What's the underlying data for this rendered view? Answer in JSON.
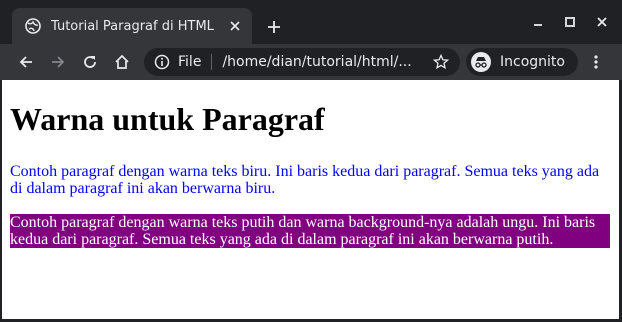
{
  "browser": {
    "tab_title": "Tutorial Paragraf di HTML",
    "omnibox_scheme_label": "File",
    "omnibox_url": "/home/dian/tutorial/html/...",
    "incognito_label": "Incognito"
  },
  "page": {
    "heading": "Warna untuk Paragraf",
    "paragraph_blue": "Contoh paragraf dengan warna teks biru. Ini baris kedua dari paragraf. Semua teks yang ada di dalam paragraf ini akan berwarna biru.",
    "paragraph_purple": "Contoh paragraf dengan warna teks putih dan warna background-nya adalah ungu. Ini baris kedua dari paragraf. Semua teks yang ada di dalam paragraf ini akan berwarna putih."
  },
  "colors": {
    "chrome_dark": "#202124",
    "chrome_toolbar": "#35363a",
    "blue_text": "#0000ff",
    "purple_background": "#800080"
  },
  "icons": [
    "globe-icon",
    "close-icon",
    "plus-icon",
    "minimize-icon",
    "maximize-icon",
    "back-icon",
    "forward-icon",
    "reload-icon",
    "home-icon",
    "info-icon",
    "star-icon",
    "incognito-icon",
    "kebab-menu-icon"
  ]
}
